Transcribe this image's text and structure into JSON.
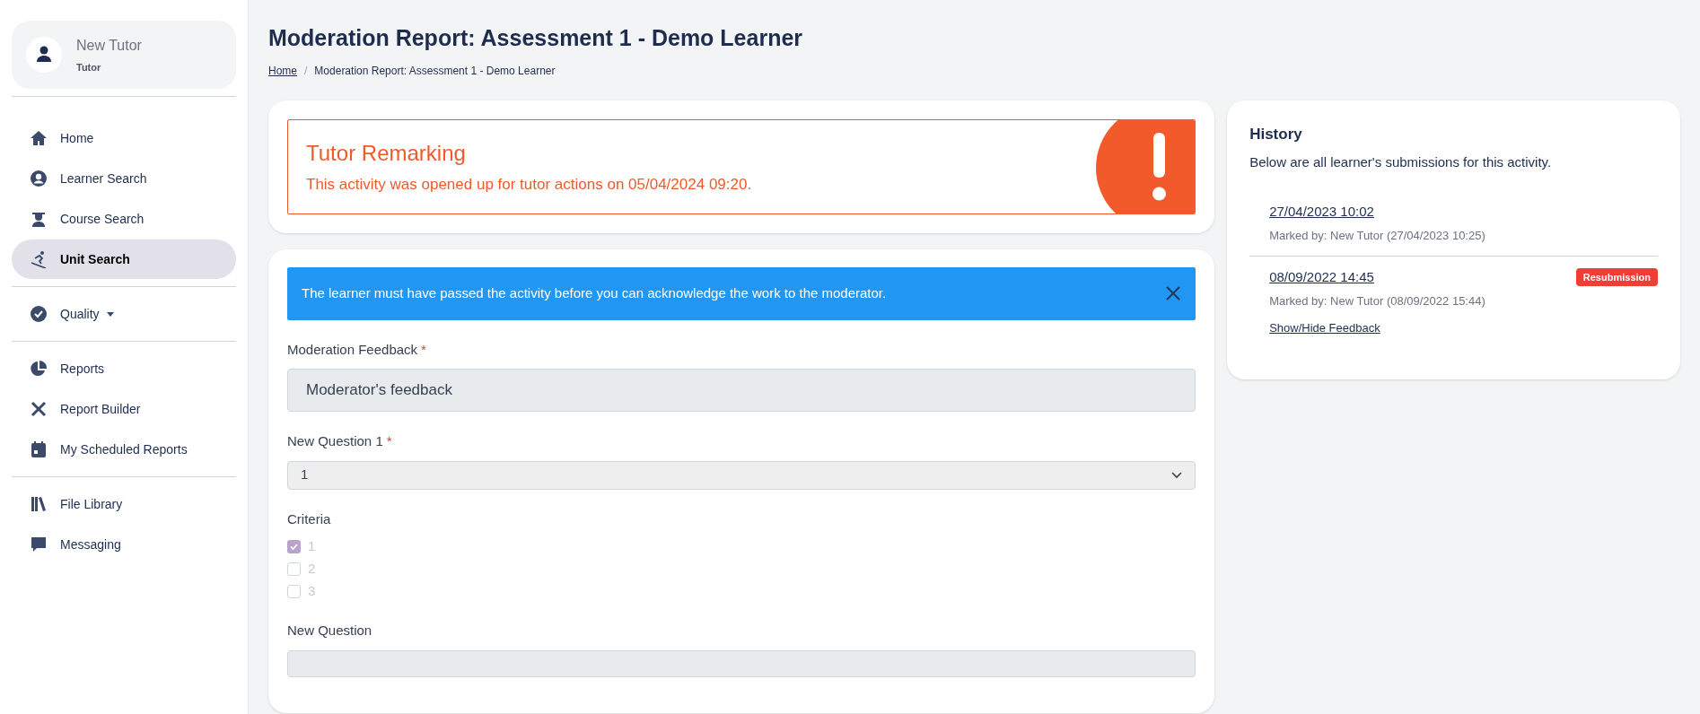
{
  "sidebar": {
    "user": {
      "name": "New Tutor",
      "role": "Tutor"
    },
    "groups": [
      {
        "items": [
          {
            "label": "Home",
            "kind": "link",
            "selected": false
          },
          {
            "label": "Learner Search",
            "kind": "link",
            "selected": false
          },
          {
            "label": "Course Search",
            "kind": "link",
            "selected": false
          },
          {
            "label": "Unit Search",
            "kind": "link",
            "selected": true
          }
        ]
      },
      {
        "items": [
          {
            "label": "Quality",
            "kind": "dropdown",
            "selected": false
          }
        ]
      },
      {
        "items": [
          {
            "label": "Reports",
            "kind": "link",
            "selected": false
          },
          {
            "label": "Report Builder",
            "kind": "link",
            "selected": false
          },
          {
            "label": "My Scheduled Reports",
            "kind": "link",
            "selected": false
          }
        ]
      },
      {
        "items": [
          {
            "label": "File Library",
            "kind": "link",
            "selected": false
          },
          {
            "label": "Messaging",
            "kind": "link",
            "selected": false
          }
        ]
      }
    ]
  },
  "page": {
    "title": "Moderation Report: Assessment 1 - Demo Learner",
    "breadcrumb_separator": "/",
    "breadcrumb": [
      {
        "label": "Home",
        "kind": "link"
      },
      {
        "label": "Moderation Report: Assessment 1 - Demo Learner",
        "kind": "current"
      }
    ]
  },
  "alert": {
    "title": "Tutor Remarking",
    "message": "This activity was opened up for tutor actions on 05/04/2024 09:20."
  },
  "form": {
    "banner": "The learner must have passed the activity before you can acknowledge the work to the moderator.",
    "fields": [
      {
        "kind": "textarea",
        "label": "Moderation Feedback",
        "required_mark": "*",
        "value": "Moderator's feedback"
      },
      {
        "kind": "select",
        "label": "New Question 1",
        "required_mark": "*",
        "value": "1"
      },
      {
        "kind": "checkboxes",
        "label": "Criteria",
        "options": [
          {
            "label": "1",
            "checked": true
          },
          {
            "label": "2",
            "checked": false
          },
          {
            "label": "3",
            "checked": false
          }
        ]
      },
      {
        "kind": "text",
        "label": "New Question"
      }
    ]
  },
  "history": {
    "title": "History",
    "description": "Below are all learner's submissions for this activity.",
    "entries": [
      {
        "date": "27/04/2023 10:02",
        "marked_by": "Marked by: New Tutor (27/04/2023 10:25)"
      },
      {
        "date": "08/09/2022 14:45",
        "marked_by": "Marked by: New Tutor (08/09/2022 15:44)",
        "badge": "Resubmission",
        "link": "Show/Hide Feedback"
      }
    ]
  }
}
